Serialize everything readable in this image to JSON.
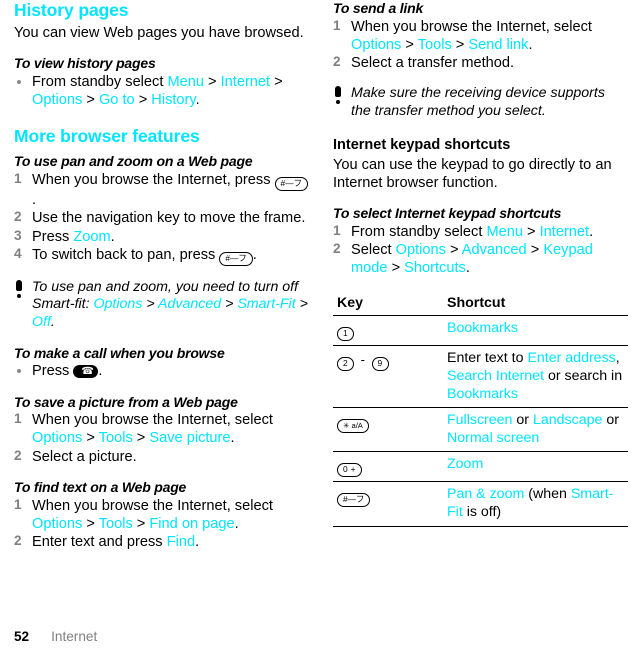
{
  "document": {
    "footer": {
      "page_number": "52",
      "chapter": "Internet"
    },
    "accent_color": "#00e5ff"
  },
  "left_column": {
    "history": {
      "title": "History pages",
      "intro": "You can view Web pages you have browsed.",
      "procedure_title": "To view history pages",
      "bullet_1": {
        "pre": "From standby select ",
        "link_1": "Menu",
        "sep_1": " > ",
        "link_2": "Internet",
        "sep_2": " > ",
        "link_3": "Options",
        "sep_3": " > ",
        "link_4": "Go to",
        "sep_4": " > ",
        "link_5": "History",
        "post": "."
      }
    },
    "more_features": {
      "title": "More browser features",
      "panzoom": {
        "procedure_title": "To use pan and zoom on a Web page",
        "step_1_pre": "When you browse the Internet, press ",
        "step_1_key": "#—フ",
        "step_1_post": ".",
        "step_2": "Use the navigation key to move the frame.",
        "step_3_pre": "Press ",
        "step_3_link": "Zoom",
        "step_3_post": ".",
        "step_4_pre": "To switch back to pan, press ",
        "step_4_key": "#—フ",
        "step_4_post": "."
      },
      "tip": {
        "pre": "To use pan and zoom, you need to turn off Smart-fit: ",
        "link_1": "Options",
        "sep_1": " > ",
        "link_2": "Advanced",
        "sep_2": " > ",
        "link_3": "Smart-Fit",
        "sep_3": " > ",
        "link_4": "Off",
        "post": "."
      },
      "call": {
        "procedure_title": "To make a call when you browse",
        "bullet_pre": "Press ",
        "bullet_key": "call-key",
        "bullet_post": "."
      },
      "save_picture": {
        "procedure_title": "To save a picture from a Web page",
        "step_1_pre": "When you browse the Internet, select ",
        "step_1_link_1": "Options",
        "step_1_sep_1": " > ",
        "step_1_link_2": "Tools",
        "step_1_sep_2": " > ",
        "step_1_link_3": "Save picture",
        "step_1_post": ".",
        "step_2": "Select a picture."
      },
      "find_text": {
        "procedure_title": "To find text on a Web page",
        "step_1_pre": "When you browse the Internet, select ",
        "step_1_link_1": "Options",
        "step_1_sep_1": " > ",
        "step_1_link_2": "Tools",
        "step_1_sep_2": " > ",
        "step_1_link_3": "Find on page",
        "step_1_post": ".",
        "step_2_pre": "Enter text and press ",
        "step_2_link": "Find",
        "step_2_post": "."
      }
    }
  },
  "right_column": {
    "send_link": {
      "procedure_title": "To send a link",
      "step_1_pre": "When you browse the Internet, select ",
      "step_1_link_1": "Options",
      "step_1_sep_1": " > ",
      "step_1_link_2": "Tools",
      "step_1_sep_2": " > ",
      "step_1_link_3": "Send link",
      "step_1_post": ".",
      "step_2": "Select a transfer method.",
      "tip": "Make sure the receiving device supports the transfer method you select."
    },
    "keypad_shortcuts": {
      "title": "Internet keypad shortcuts",
      "intro": "You can use the keypad to go directly to an Internet browser function.",
      "procedure_title": "To select Internet keypad shortcuts",
      "step_1_pre": "From standby select ",
      "step_1_link_1": "Menu",
      "step_1_sep_1": " > ",
      "step_1_link_2": "Internet",
      "step_1_post": ".",
      "step_2_pre": "Select ",
      "step_2_link_1": "Options",
      "step_2_sep_1": " > ",
      "step_2_link_2": "Advanced",
      "step_2_sep_2": " > ",
      "step_2_link_3": "Keypad mode",
      "step_2_sep_3": " > ",
      "step_2_link_4": "Shortcuts",
      "step_2_post": "."
    },
    "table": {
      "headers": {
        "key": "Key",
        "shortcut": "Shortcut"
      },
      "rows": [
        {
          "key_glyphs": [
            "1"
          ],
          "shortcut_parts": [
            {
              "text": "Bookmarks",
              "style": "cyan"
            }
          ]
        },
        {
          "key_glyphs": [
            "2",
            "-",
            "9"
          ],
          "shortcut_parts": [
            {
              "text": "Enter text to ",
              "style": "plain"
            },
            {
              "text": "Enter address",
              "style": "cyan"
            },
            {
              "text": ", ",
              "style": "plain"
            },
            {
              "text": "Search Internet",
              "style": "cyan"
            },
            {
              "text": " or search in ",
              "style": "plain"
            },
            {
              "text": "Bookmarks",
              "style": "cyan"
            }
          ]
        },
        {
          "key_glyphs": [
            "✳ a/A"
          ],
          "shortcut_parts": [
            {
              "text": "Fullscreen",
              "style": "cyan"
            },
            {
              "text": " or ",
              "style": "plain"
            },
            {
              "text": "Landscape",
              "style": "cyan"
            },
            {
              "text": " or ",
              "style": "plain"
            },
            {
              "text": "Normal screen",
              "style": "cyan"
            }
          ]
        },
        {
          "key_glyphs": [
            "0 +"
          ],
          "shortcut_parts": [
            {
              "text": "Zoom",
              "style": "cyan"
            }
          ]
        },
        {
          "key_glyphs": [
            "#—フ"
          ],
          "shortcut_parts": [
            {
              "text": "Pan & zoom",
              "style": "cyan"
            },
            {
              "text": " (when ",
              "style": "plain"
            },
            {
              "text": "Smart-Fit",
              "style": "cyan"
            },
            {
              "text": " is off)",
              "style": "plain"
            }
          ]
        }
      ]
    }
  }
}
